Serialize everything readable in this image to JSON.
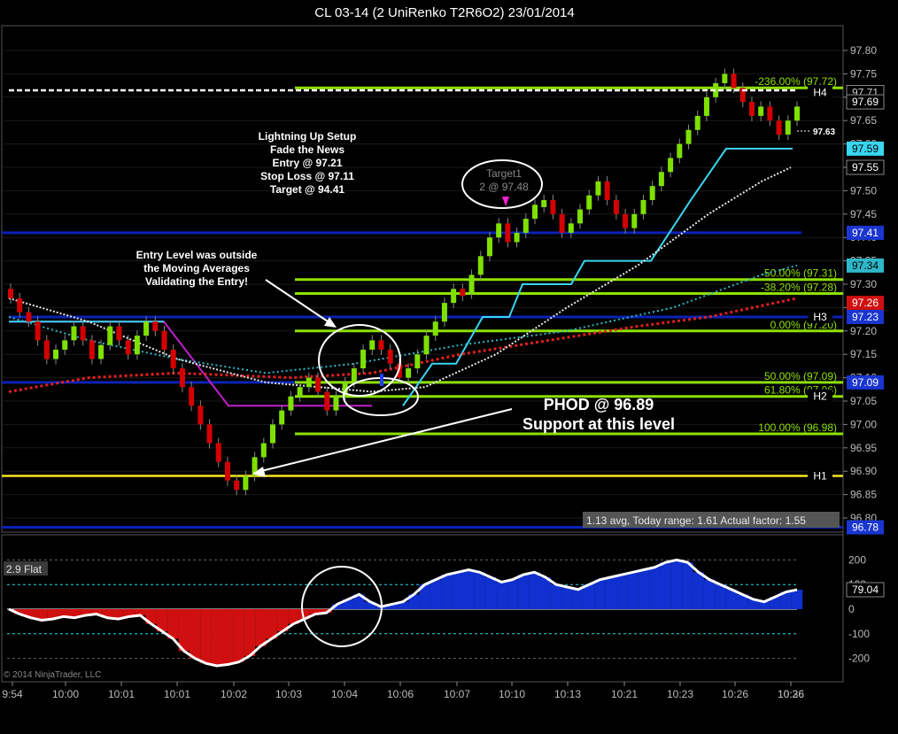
{
  "title": "CL 03-14 (2 UniRenko T2R6O2)  23/01/2014",
  "copyright": "© 2014 NinjaTrader, LLC",
  "colors": {
    "background": "#000000",
    "up_bar": "#7fe000",
    "down_bar": "#d40000",
    "fib_line": "#8ee000",
    "blue_level": "#0a23b5",
    "yellow_line": "#f5e51c",
    "cyan_line": "#38d6f0",
    "magenta_line": "#c020c8",
    "red_dots": "#e02020",
    "white_dots": "#e8e8e8",
    "teal_dots": "#2fb8c8"
  },
  "chart_data": [
    {
      "type": "line",
      "name": "price-panel",
      "y_range": [
        96.78,
        97.82
      ],
      "y_ticks": [
        "97.80",
        "97.75",
        "97.70",
        "97.65",
        "97.60",
        "97.55",
        "97.50",
        "97.45",
        "97.40",
        "97.35",
        "97.30",
        "97.25",
        "97.20",
        "97.15",
        "97.10",
        "97.05",
        "97.00",
        "96.95",
        "96.90",
        "96.85",
        "96.80"
      ],
      "x_labels": [
        "9:54",
        "10:00",
        "10:01",
        "10:01",
        "10:02",
        "10:03",
        "10:04",
        "10:06",
        "10:07",
        "10:10",
        "10:13",
        "10:21",
        "10:23",
        "10:26",
        "10:26",
        "10:36"
      ],
      "renko_bars": [
        97.27,
        97.24,
        97.22,
        97.18,
        97.14,
        97.16,
        97.18,
        97.21,
        97.18,
        97.14,
        97.17,
        97.21,
        97.18,
        97.15,
        97.19,
        97.22,
        97.2,
        97.16,
        97.12,
        97.08,
        97.04,
        97.0,
        96.96,
        96.92,
        96.88,
        96.86,
        96.89,
        96.93,
        96.96,
        97.0,
        97.03,
        97.06,
        97.08,
        97.1,
        97.07,
        97.03,
        97.06,
        97.09,
        97.12,
        97.16,
        97.18,
        97.16,
        97.13,
        97.1,
        97.12,
        97.15,
        97.19,
        97.22,
        97.26,
        97.29,
        97.28,
        97.32,
        97.36,
        97.4,
        97.43,
        97.39,
        97.41,
        97.44,
        97.47,
        97.48,
        97.45,
        97.41,
        97.43,
        97.46,
        97.49,
        97.52,
        97.48,
        97.45,
        97.42,
        97.45,
        97.48,
        97.51,
        97.54,
        97.57,
        97.6,
        97.63,
        97.66,
        97.7,
        97.73,
        97.75,
        97.72,
        97.69,
        97.66,
        97.68,
        97.65,
        97.62,
        97.65,
        97.68
      ],
      "horizontal_levels": [
        {
          "label": "-236.00% (97.72)",
          "value": 97.72
        },
        {
          "label": "-50.00% (97.31)",
          "value": 97.31
        },
        {
          "label": "-38.20% (97.28)",
          "value": 97.28
        },
        {
          "label": "0.00% (97.20)",
          "value": 97.2
        },
        {
          "label": "50.00% (97.09)",
          "value": 97.09
        },
        {
          "label": "61.80% (97.06)",
          "value": 97.06
        },
        {
          "label": "100.00% (96.98)",
          "value": 96.98
        }
      ],
      "pivot_labels": [
        {
          "label": "H4",
          "value": 97.71
        },
        {
          "label": "H3",
          "value": 97.23
        },
        {
          "label": "H2",
          "value": 97.06
        },
        {
          "label": "H1",
          "value": 96.89
        }
      ],
      "price_badges": [
        {
          "text": "97.71",
          "value": 97.71,
          "bg": "#000000",
          "fg": "#cccccc"
        },
        {
          "text": "97.69",
          "value": 97.69,
          "bg": "#000000",
          "fg": "#ffffff"
        },
        {
          "text": "97.59",
          "value": 97.59,
          "bg": "#38d6f0",
          "fg": "#000000"
        },
        {
          "text": "97.55",
          "value": 97.55,
          "bg": "#000000",
          "fg": "#ffffff"
        },
        {
          "text": "97.41",
          "value": 97.41,
          "bg": "#1a35d0",
          "fg": "#ffffff"
        },
        {
          "text": "97.34",
          "value": 97.34,
          "bg": "#2fb8c8",
          "fg": "#000000"
        },
        {
          "text": "97.26",
          "value": 97.26,
          "bg": "#d01010",
          "fg": "#ffffff"
        },
        {
          "text": "97.23",
          "value": 97.23,
          "bg": "#1a35d0",
          "fg": "#ffffff"
        },
        {
          "text": "97.09",
          "value": 97.09,
          "bg": "#1a35d0",
          "fg": "#ffffff"
        },
        {
          "text": "96.78",
          "value": 96.78,
          "bg": "#1a35d0",
          "fg": "#ffffff"
        }
      ],
      "small_price_label": "97.63",
      "stats_bar": "1.13 avg, Today range: 1.61  Actual factor: 1.55",
      "target_label": [
        "Target1",
        "2 @ 97.48"
      ]
    },
    {
      "type": "area",
      "name": "oscillator-panel",
      "indicator_label": "2.9 Flat",
      "y_ticks": [
        "200",
        "100",
        "0",
        "-100",
        "-200"
      ],
      "y_range": [
        -230,
        220
      ],
      "current_value": "79.04",
      "values": [
        0,
        -20,
        -35,
        -45,
        -40,
        -30,
        -35,
        -25,
        -20,
        -35,
        -40,
        -30,
        -25,
        -60,
        -90,
        -120,
        -170,
        -200,
        -220,
        -230,
        -225,
        -215,
        -190,
        -150,
        -120,
        -90,
        -60,
        -40,
        -20,
        -15,
        20,
        40,
        60,
        30,
        10,
        20,
        30,
        60,
        100,
        120,
        140,
        150,
        160,
        150,
        130,
        110,
        120,
        140,
        150,
        130,
        100,
        90,
        80,
        100,
        120,
        130,
        140,
        150,
        160,
        170,
        190,
        200,
        190,
        150,
        120,
        100,
        80,
        60,
        40,
        30,
        50,
        70,
        79
      ]
    }
  ],
  "annotations": {
    "setup": [
      "Lightning Up Setup",
      "Fade the News",
      "Entry @  97.21",
      "Stop Loss @ 97.11",
      "Target @ 94.41"
    ],
    "entry_level": [
      "Entry Level was outside",
      "the Moving Averages",
      "Validating the Entry!"
    ],
    "phod": [
      "PHOD @ 96.89",
      "Support at this level"
    ]
  }
}
